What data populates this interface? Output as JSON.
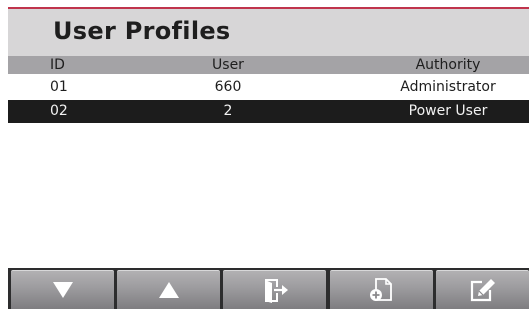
{
  "header": {
    "title": "User Profiles"
  },
  "table": {
    "columns": {
      "id": "ID",
      "user": "User",
      "authority": "Authority"
    },
    "rows": [
      {
        "id": "01",
        "user": "660",
        "authority": "Administrator",
        "selected": false
      },
      {
        "id": "02",
        "user": "2",
        "authority": "Power User",
        "selected": true
      }
    ]
  },
  "toolbar": {
    "buttons": [
      {
        "icon": "arrow-down-icon"
      },
      {
        "icon": "arrow-up-icon"
      },
      {
        "icon": "exit-icon"
      },
      {
        "icon": "add-document-icon"
      },
      {
        "icon": "edit-icon"
      }
    ]
  },
  "colors": {
    "accent": "#c0344c",
    "title_bar": "#d7d6d7",
    "header_bar": "#a4a3a6",
    "selected_row": "#1c1c1c",
    "toolbar": "#2d2d2e"
  }
}
